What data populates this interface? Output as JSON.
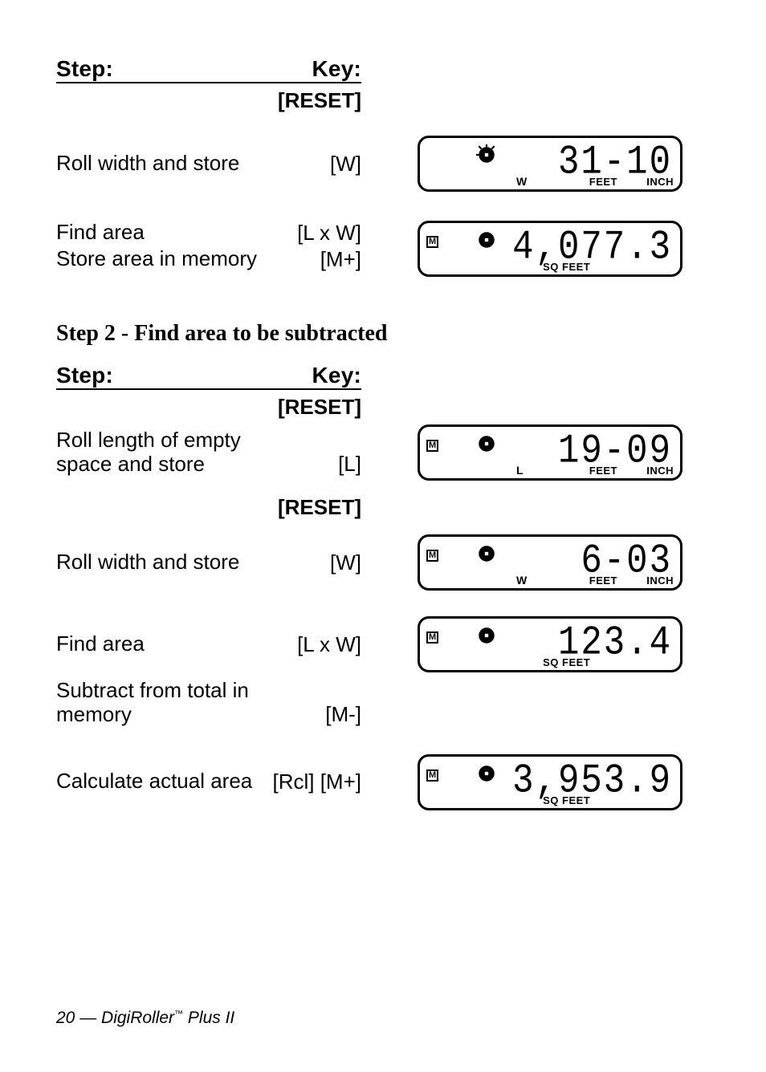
{
  "headers": {
    "step": "Step:",
    "key": "Key:"
  },
  "section1": {
    "rows": [
      {
        "desc": "",
        "key": "[RESET]",
        "keyBold": true,
        "lcd": null
      },
      {
        "desc": "Roll width and store",
        "key": "[W]",
        "keyBold": false,
        "lcd": {
          "m": false,
          "value": "31-10",
          "sub_lw": "W",
          "sub_feet": "FEET",
          "sub_inch": "INCH"
        }
      },
      {
        "desc": "Find area",
        "key": "[L x W]",
        "keyBold": false,
        "lcd": null
      },
      {
        "desc": "Store area in memory",
        "key": "[M+]",
        "keyBold": false,
        "lcd": {
          "m": true,
          "value": "4,077.3",
          "sub_sq": "SQ FEET"
        },
        "merge_up_lcd": true
      }
    ]
  },
  "section2": {
    "title": "Step 2 - Find area to be subtracted",
    "rows": [
      {
        "desc": "",
        "key": "[RESET]",
        "keyBold": true,
        "lcd": null
      },
      {
        "desc": "Roll length of empty space and store",
        "key": "[L]",
        "keyBold": false,
        "lcd": {
          "m": true,
          "value": "19-09",
          "sub_lw": "L",
          "sub_feet": "FEET",
          "sub_inch": "INCH"
        }
      },
      {
        "desc": "",
        "key": "[RESET]",
        "keyBold": true,
        "lcd": null
      },
      {
        "desc": "Roll width and store",
        "key": "[W]",
        "keyBold": false,
        "lcd": {
          "m": true,
          "value": "6-03",
          "sub_lw": "W",
          "sub_feet": "FEET",
          "sub_inch": "INCH"
        }
      },
      {
        "desc": "Find area",
        "key": "[L x W]",
        "keyBold": false,
        "lcd": {
          "m": true,
          "value": "123.4",
          "sub_sq": "SQ FEET"
        }
      },
      {
        "desc": "Subtract from total in memory",
        "key": "[M-]",
        "keyBold": false,
        "lcd": null
      },
      {
        "desc": "Calculate actual area",
        "key": "[Rcl] [M+]",
        "keyBold": false,
        "lcd": {
          "m": true,
          "value": "3,953.9",
          "sub_sq": "SQ FEET"
        }
      }
    ]
  },
  "footer": {
    "page": "20",
    "sep": " — ",
    "product1": "DigiRoller",
    "tm": "™",
    "product2": " Plus II"
  }
}
